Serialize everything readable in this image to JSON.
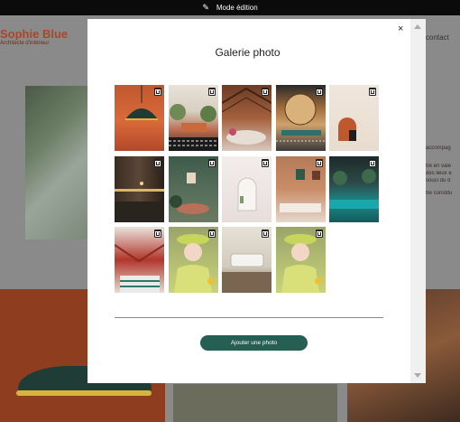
{
  "topbar": {
    "mode_label": "Mode édition",
    "icon": "pen-icon"
  },
  "background": {
    "brand": "Sophie Blue",
    "brand_sub": "Architecte d'intérieur",
    "nav_contact": "contact",
    "text_lines": [
      "accompag",
      "tre en vale",
      "des lieux e",
      "souci du d",
      "tre constitu"
    ]
  },
  "modal": {
    "title": "Galerie photo",
    "close_label": "×",
    "add_button_label": "Ajouter une photo",
    "photos": [
      {
        "subject": "orange lamp"
      },
      {
        "subject": "patterned living room"
      },
      {
        "subject": "wooden hall"
      },
      {
        "subject": "rattan shelves"
      },
      {
        "subject": "arched wall"
      },
      {
        "subject": "dark kitchen"
      },
      {
        "subject": "green room"
      },
      {
        "subject": "white alcove"
      },
      {
        "subject": "terracotta interior"
      },
      {
        "subject": "teal bar"
      },
      {
        "subject": "red restaurant"
      },
      {
        "subject": "queen portrait"
      },
      {
        "subject": "white sofa"
      },
      {
        "subject": "queen portrait"
      }
    ]
  },
  "colors": {
    "accent": "#255e52",
    "brand": "#a6482b"
  }
}
